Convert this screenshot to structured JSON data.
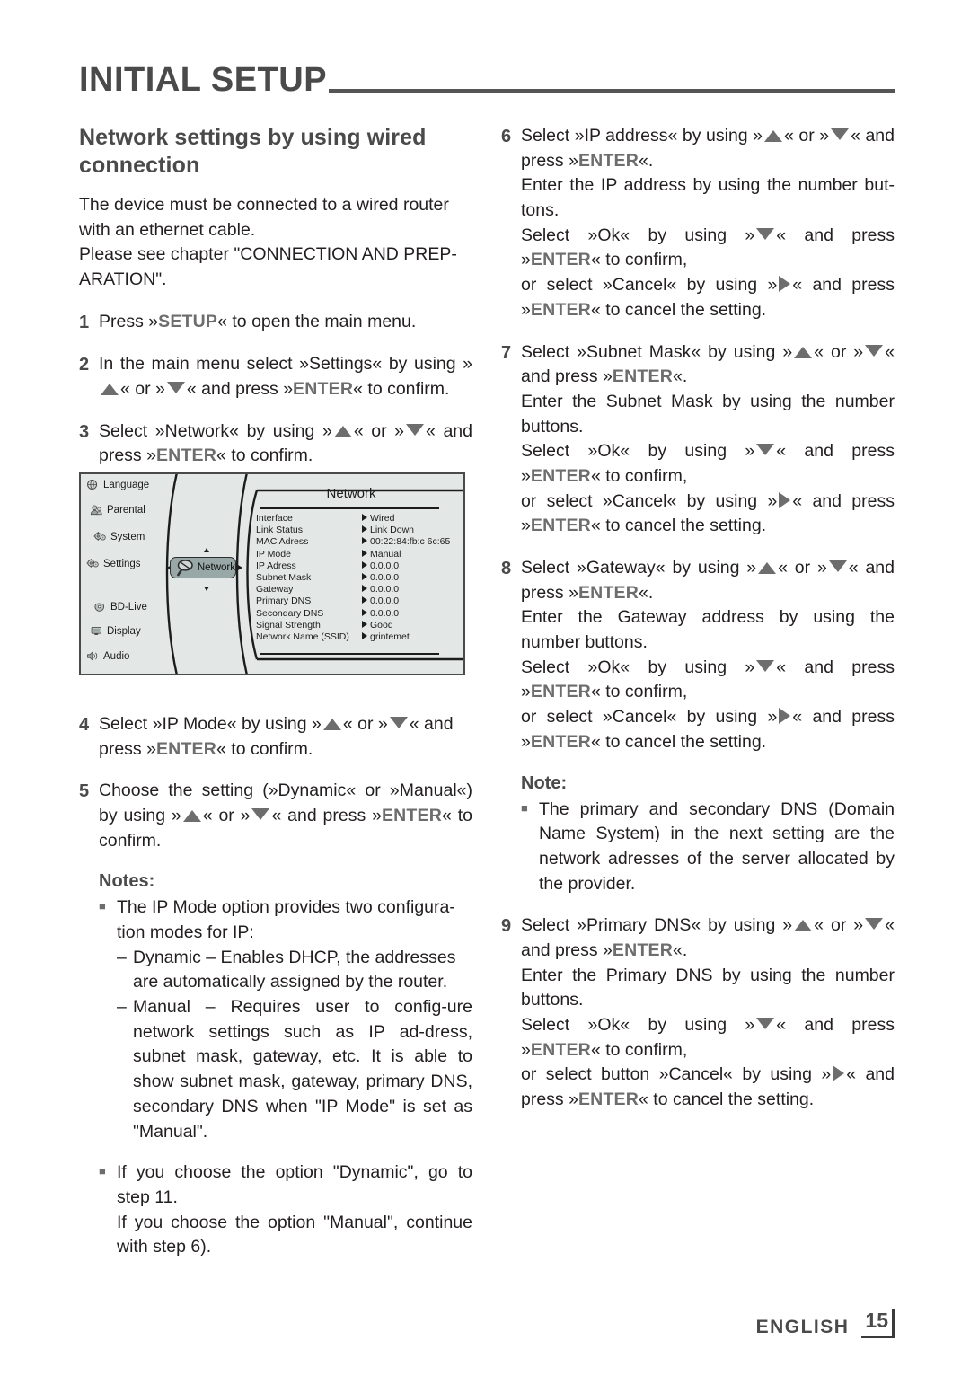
{
  "header": {
    "title": "INITIAL SETUP"
  },
  "left_column": {
    "section_title": "Network settings by using wired connection",
    "intro_1": "The device must be connected to a wired router with an ethernet cable.",
    "intro_2": "Please see chapter \"CONNECTION AND PREP-ARATION\".",
    "steps": [
      {
        "num": "1",
        "parts": [
          "Press »",
          "SETUP",
          "« to open the main menu."
        ]
      },
      {
        "num": "2",
        "parts": [
          "In the main menu select »Settings« by using »",
          "up-arrow",
          "« or »",
          "down-arrow",
          "« and press »",
          "ENTER",
          "« to confirm."
        ]
      },
      {
        "num": "3",
        "parts": [
          "Select »Network« by using »",
          "up-arrow",
          "« or »",
          "down-arrow",
          "« and press »",
          "ENTER",
          "« to confirm."
        ]
      },
      {
        "num": "4",
        "parts": [
          "Select »IP Mode« by using »",
          "up-arrow",
          "« or »",
          "down-arrow",
          "« and press »",
          "ENTER",
          "« to confirm."
        ]
      },
      {
        "num": "5",
        "parts": [
          "Choose the setting (»Dynamic« or »Manual«) by using »",
          "up-arrow",
          "« or »",
          "down-arrow",
          "« and press »",
          "ENTER",
          "« to confirm."
        ]
      }
    ],
    "notes_heading": "Notes:",
    "note_1_line1": "The IP Mode option provides two configura-tion modes for IP:",
    "note_1_dash_1": "Dynamic – Enables DHCP, the addresses are automatically assigned by the router.",
    "note_1_dash_2": "Manual – Requires user to config-ure network settings such as IP ad-dress, subnet mask, gateway, etc. It is able to show subnet mask, gateway, primary DNS, secondary DNS when \"IP Mode\" is set as \"Manual\".",
    "note_2_line1": "If you choose the option \"Dynamic\", go to step 11.",
    "note_2_line2": "If you choose the option \"Manual\", continue with step 6)."
  },
  "right_column": {
    "steps": [
      {
        "num": "6",
        "title_a": "Select »IP address« by using »",
        "title_arrow_1": "up-arrow",
        "title_b": "« or »",
        "title_arrow_2": "down-arrow",
        "title_c": "« and press »",
        "title_kbd": "ENTER",
        "title_d": "«.",
        "line_enter": "Enter the IP address by using the number but-tons.",
        "line_ok_a": "Select »Ok« by using »",
        "line_ok_arrow": "down-arrow",
        "line_ok_b": "« and press »",
        "line_ok_kbd": "ENTER",
        "line_ok_c": "« to confirm,",
        "line_cancel_a": "or select »Cancel« by using »",
        "line_cancel_arrow": "right-arrow",
        "line_cancel_b": "« and press »",
        "line_cancel_kbd": "ENTER",
        "line_cancel_c": "« to cancel the setting."
      },
      {
        "num": "7",
        "title_a": "Select »Subnet Mask« by using »",
        "title_arrow_1": "up-arrow",
        "title_b": "« or »",
        "title_arrow_2": "down-arrow",
        "title_c": "« and press »",
        "title_kbd": "ENTER",
        "title_d": "«.",
        "line_enter": "Enter the Subnet Mask by using the number buttons.",
        "line_ok_a": "Select »Ok« by using »",
        "line_ok_arrow": "down-arrow",
        "line_ok_b": "« and press »",
        "line_ok_kbd": "ENTER",
        "line_ok_c": "« to confirm,",
        "line_cancel_a": "or select »Cancel« by using »",
        "line_cancel_arrow": "right-arrow",
        "line_cancel_b": "« and press »",
        "line_cancel_kbd": "ENTER",
        "line_cancel_c": "« to cancel the setting."
      },
      {
        "num": "8",
        "title_a": "Select »Gateway« by using »",
        "title_arrow_1": "up-arrow",
        "title_b": "« or »",
        "title_arrow_2": "down-arrow",
        "title_c": "« and press »",
        "title_kbd": "ENTER",
        "title_d": "«.",
        "line_enter": "Enter the Gateway address by using the number buttons.",
        "line_ok_a": "Select »Ok« by using »",
        "line_ok_arrow": "down-arrow",
        "line_ok_b": "« and press »",
        "line_ok_kbd": "ENTER",
        "line_ok_c": "« to confirm,",
        "line_cancel_a": "or select »Cancel« by using »",
        "line_cancel_arrow": "right-arrow",
        "line_cancel_b": "« and press »",
        "line_cancel_kbd": "ENTER",
        "line_cancel_c": "« to cancel the setting."
      },
      {
        "num": "9",
        "title_a": "Select »Primary DNS« by using »",
        "title_arrow_1": "up-arrow",
        "title_b": "« or »",
        "title_arrow_2": "down-arrow",
        "title_c": "« and press »",
        "title_kbd": "ENTER",
        "title_d": "«.",
        "line_enter": "Enter the Primary DNS by using the number buttons.",
        "line_ok_a": "Select »Ok« by using »",
        "line_ok_arrow": "down-arrow",
        "line_ok_b": "« and press »",
        "line_ok_kbd": "ENTER",
        "line_ok_c": "« to confirm,",
        "line_cancel_a": "or select button »Cancel« by using »",
        "line_cancel_arrow": "right-arrow",
        "line_cancel_b": "« and press »",
        "line_cancel_kbd": "ENTER",
        "line_cancel_c": "« to cancel the setting."
      }
    ],
    "note_heading": "Note:",
    "note_text": "The primary and secondary DNS (Domain Name System) in the next setting are the network adresses of the server allocated by the provider."
  },
  "figure": {
    "sidebar_root": {
      "label": "Settings",
      "icon": "gear-icon"
    },
    "sidebar_items": [
      {
        "label": "Language",
        "icon": "globe-icon"
      },
      {
        "label": "Parental",
        "icon": "parental-icon"
      },
      {
        "label": "System",
        "icon": "gear-icon"
      },
      {
        "label": "Network",
        "icon": "network-icon"
      },
      {
        "label": "BD-Live",
        "icon": "disc-icon"
      },
      {
        "label": "Display",
        "icon": "display-icon"
      },
      {
        "label": "Audio",
        "icon": "audio-icon"
      }
    ],
    "selected_item": "Network",
    "panel_title": "Network",
    "panel_rows": [
      {
        "key": "Interface",
        "value": "Wired"
      },
      {
        "key": "Link Status",
        "value": "Link Down"
      },
      {
        "key": "MAC Adress",
        "value": "00:22:84:fb:c 6c:65"
      },
      {
        "key": "IP Mode",
        "value": "Manual"
      },
      {
        "key": "IP Adress",
        "value": "0.0.0.0"
      },
      {
        "key": "Subnet Mask",
        "value": "0.0.0.0"
      },
      {
        "key": "Gateway",
        "value": "0.0.0.0"
      },
      {
        "key": "Primary DNS",
        "value": "0.0.0.0"
      },
      {
        "key": "Secondary DNS",
        "value": "0.0.0.0"
      },
      {
        "key": "Signal Strength",
        "value": "Good"
      },
      {
        "key": "Network Name (SSID)",
        "value": "grintemet"
      }
    ]
  },
  "footer": {
    "language": "ENGLISH",
    "page": "15"
  },
  "colors": {
    "heading_gray": "#4a4a4a",
    "body_black": "#231f20",
    "kbd_gray": "#6d6d6d",
    "figure_bg": "#e3e8e7",
    "figure_highlight": "#98a8a6"
  }
}
